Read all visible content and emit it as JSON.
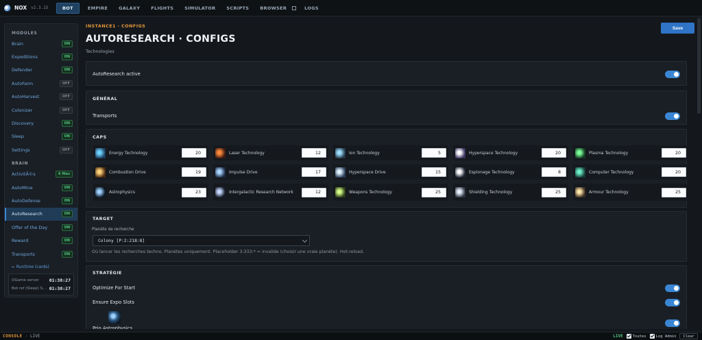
{
  "topbar": {
    "app_name": "NOX",
    "version": "v2.3.15",
    "tabs": [
      {
        "label": "BOT",
        "active": true
      },
      {
        "label": "EMPIRE"
      },
      {
        "label": "GALAXY"
      },
      {
        "label": "FLIGHTS"
      },
      {
        "label": "SIMULATOR"
      },
      {
        "label": "SCRIPTS"
      },
      {
        "label": "BROWSER"
      },
      {
        "label": "LOGS"
      }
    ],
    "external_icon": "external-link-icon"
  },
  "sidebar": {
    "modules_header": "MODULES",
    "modules": [
      {
        "label": "Brain",
        "badge": "ON"
      },
      {
        "label": "Expeditions",
        "badge": "ON"
      },
      {
        "label": "Defender",
        "badge": "ON"
      },
      {
        "label": "AutoFarm",
        "badge": "OFF"
      },
      {
        "label": "AutoHarvest",
        "badge": "OFF"
      },
      {
        "label": "Colonizer",
        "badge": "OFF"
      },
      {
        "label": "Discovery",
        "badge": "ON"
      },
      {
        "label": "Sleep",
        "badge": "ON"
      },
      {
        "label": "Settings",
        "badge": "OFF"
      }
    ],
    "brain_header": "BRAIN",
    "brain": [
      {
        "label": "ActivitÃ©s",
        "badge": "6 files"
      },
      {
        "label": "AutoMine",
        "badge": "ON"
      },
      {
        "label": "AutoDefense",
        "badge": "ON"
      },
      {
        "label": "AutoResearch",
        "badge": "ON",
        "selected": true
      },
      {
        "label": "Offer of the Day",
        "badge": "ON"
      },
      {
        "label": "Reward",
        "badge": "ON"
      },
      {
        "label": "Transports",
        "badge": "ON"
      }
    ],
    "runtime_link": "← Runtime (cards)",
    "clock": [
      {
        "label": "OGame server",
        "time": "01:38:27"
      },
      {
        "label": "Bot ref (Sleep) S...",
        "time": "01:38:27"
      }
    ]
  },
  "page": {
    "breadcrumb": "INSTANCE1 · CONFIGS",
    "title": "AUTORESEARCH · CONFIGS",
    "subtitle": "Technologies",
    "save_label": "Save",
    "active_label": "AutoResearch active",
    "active_on": true
  },
  "general": {
    "title": "GÉNÉRAL",
    "transports_label": "Transports",
    "transports_on": true
  },
  "caps": {
    "title": "CAPS",
    "techs": [
      {
        "name": "Energy Technology",
        "value": "20",
        "icon": "energy-tech-icon"
      },
      {
        "name": "Laser Technology",
        "value": "12",
        "icon": "laser-tech-icon"
      },
      {
        "name": "Ion Technology",
        "value": "5",
        "icon": "ion-tech-icon"
      },
      {
        "name": "Hyperspace Technology",
        "value": "20",
        "icon": "hyperspace-tech-icon"
      },
      {
        "name": "Plasma Technology",
        "value": "20",
        "icon": "plasma-tech-icon"
      },
      {
        "name": "Combustion Drive",
        "value": "19",
        "icon": "combustion-drive-icon"
      },
      {
        "name": "Impulse Drive",
        "value": "17",
        "icon": "impulse-drive-icon"
      },
      {
        "name": "Hyperspace Drive",
        "value": "15",
        "icon": "hyperspace-drive-icon"
      },
      {
        "name": "Espionage Technology",
        "value": "8",
        "icon": "espionage-tech-icon"
      },
      {
        "name": "Computer Technology",
        "value": "20",
        "icon": "computer-tech-icon"
      },
      {
        "name": "Astrophysics",
        "value": "23",
        "icon": "astrophysics-icon"
      },
      {
        "name": "Intergalactic Research Network",
        "value": "12",
        "icon": "irn-icon"
      },
      {
        "name": "Weapons Technology",
        "value": "25",
        "icon": "weapons-tech-icon"
      },
      {
        "name": "Shielding Technology",
        "value": "25",
        "icon": "shielding-tech-icon"
      },
      {
        "name": "Armour Technology",
        "value": "25",
        "icon": "armour-tech-icon"
      }
    ]
  },
  "target": {
    "title": "TARGET",
    "field_label": "Planète de recherche",
    "selected": "Colony [P:2:218:8]",
    "hint": "Où lancer les recherches techno. Planètes uniquement. Placeholder 3:333:* = invalide (choisir une vraie planète). Hot-reload."
  },
  "strategy": {
    "title": "STRATÉGIE",
    "items": [
      {
        "label": "Optimize For Start",
        "on": true
      },
      {
        "label": "Ensure Expo Slots",
        "on": true
      },
      {
        "label": "Prio Astrophysics",
        "on": true
      }
    ]
  },
  "console": {
    "label": "CONSOLE",
    "status": "· LIVE",
    "live": "LIVE",
    "filter_all": "Toutes",
    "filter_admin": "Log Admin",
    "clear": "Clear"
  }
}
